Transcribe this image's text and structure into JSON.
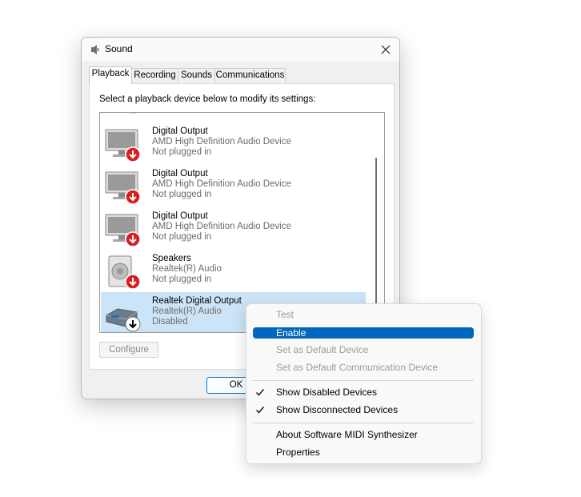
{
  "window": {
    "title": "Sound"
  },
  "tabs": [
    {
      "label": "Playback",
      "active": true
    },
    {
      "label": "Recording",
      "active": false
    },
    {
      "label": "Sounds",
      "active": false
    },
    {
      "label": "Communications",
      "active": false
    }
  ],
  "instruction": "Select a playback device below to modify its settings:",
  "devices": [
    {
      "name": "Digital Output",
      "driver": "AMD High Definition Audio Device",
      "status": "Not plugged in",
      "icon": "monitor-icon",
      "badge": "red-down-arrow"
    },
    {
      "name": "Digital Output",
      "driver": "AMD High Definition Audio Device",
      "status": "Not plugged in",
      "icon": "monitor-icon",
      "badge": "red-down-arrow"
    },
    {
      "name": "Digital Output",
      "driver": "AMD High Definition Audio Device",
      "status": "Not plugged in",
      "icon": "monitor-icon",
      "badge": "red-down-arrow"
    },
    {
      "name": "Speakers",
      "driver": "Realtek(R) Audio",
      "status": "Not plugged in",
      "icon": "speaker-icon",
      "badge": "red-down-arrow"
    },
    {
      "name": "Realtek Digital Output",
      "driver": "Realtek(R) Audio",
      "status": "Disabled",
      "icon": "digital-output-device-icon",
      "badge": "black-down-arrow",
      "selected": true
    }
  ],
  "buttons": {
    "configure": "Configure",
    "ok": "OK"
  },
  "context_menu": {
    "items": [
      {
        "label": "Test",
        "disabled": true
      },
      {
        "label": "Enable",
        "highlighted": true
      },
      {
        "label": "Set as Default Device",
        "disabled": true
      },
      {
        "label": "Set as Default Communication Device",
        "disabled": true
      },
      {
        "label": "Show Disabled Devices",
        "checked": true
      },
      {
        "label": "Show Disconnected Devices",
        "checked": true
      },
      {
        "label": "About Software MIDI Synthesizer"
      },
      {
        "label": "Properties"
      }
    ]
  },
  "colors": {
    "accent": "#0067c0",
    "selection": "#cce4f7",
    "badge_red": "#d81e1e"
  }
}
